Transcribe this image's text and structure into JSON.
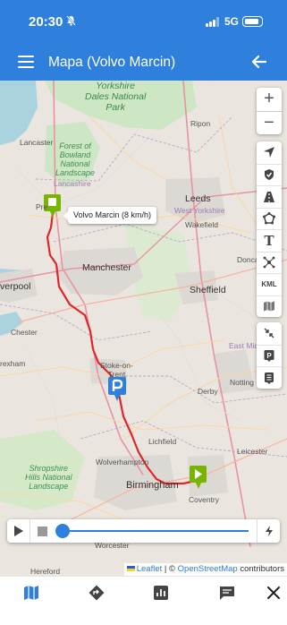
{
  "status_bar": {
    "time": "20:30",
    "network": "5G",
    "mute_icon": "bell-slash-icon"
  },
  "app_bar": {
    "title": "Mapa (Volvo Marcin)",
    "menu_icon": "hamburger-menu-icon",
    "back_icon": "arrow-left-icon"
  },
  "map": {
    "labels": {
      "yorkshire_dales": "Yorkshire\nDales National\nPark",
      "forest_bowland": "Forest of\nBowland\nNational\nLandscape",
      "lancashire": "Lancashire",
      "lancaster": "Lancaster",
      "ripon": "Ripon",
      "leeds": "Leeds",
      "west_yorkshire": "West Yorkshire",
      "wakefield": "Wakefield",
      "preston": "Pre",
      "manchester": "Manchester",
      "liverpool": "verpool",
      "sheffield": "Sheffield",
      "doncaster": "Donca",
      "chester": "Chester",
      "east_midlands": "East Midland",
      "wrexham": "rexham",
      "stoke": "Stoke-on-\nTrent",
      "derby": "Derby",
      "nottingham": "Notting",
      "lichfield": "Lichfield",
      "leicester": "Leicester",
      "wolverhampton": "Wolverhampton",
      "shropshire": "Shropshire\nHills National\nLandscape",
      "birmingham": "Birmingham",
      "coventry": "Coventry",
      "worcester": "Worcester",
      "hereford": "Hereford"
    },
    "tooltip": "Volvo Marcin (8 km/h)",
    "route_color": "#e0262a",
    "marker_color": "#79b400",
    "parking_color": "#2f7fdc",
    "zoom": {
      "in": "+",
      "out": "−"
    },
    "tools_group1": [
      "navigation-arrow-icon",
      "shield-check-icon",
      "road-icon",
      "polygon-icon",
      "text-tool-icon",
      "network-nodes-icon",
      "KML",
      "map-layers-icon"
    ],
    "kml_label": "KML",
    "text_tool_label": "T",
    "tools_group2": [
      "collapse-arrows-icon",
      "parking-icon",
      "list-badge-icon"
    ],
    "parking_label": "P",
    "playback": {
      "progress": 0.0,
      "speed_icon": "lightning-icon"
    },
    "attribution": {
      "leaflet": "Leaflet",
      "separator": "|",
      "copyright": "©",
      "osm": "OpenStreetMap",
      "contributors": "contributors"
    }
  },
  "bottom_nav": [
    "map-icon",
    "directions-icon",
    "chart-icon",
    "chat-icon",
    "close-icon"
  ]
}
